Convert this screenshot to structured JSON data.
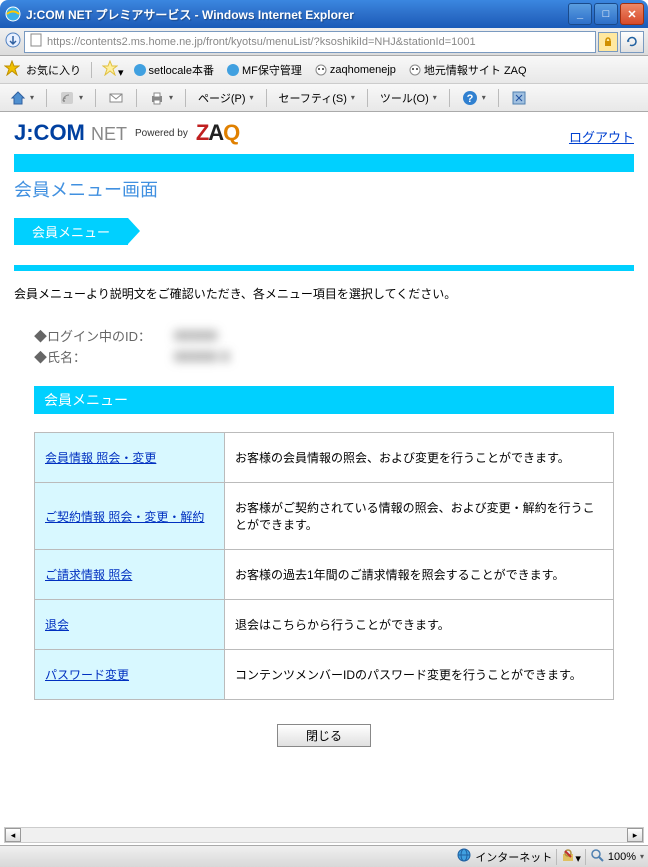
{
  "window": {
    "title": "J:COM NET プレミアサービス - Windows Internet Explorer"
  },
  "address": {
    "url": "https://contents2.ms.home.ne.jp/front/kyotsu/menuList/?ksoshikiId=NHJ&stationId=1001"
  },
  "favbar": {
    "label": "お気に入り",
    "items": [
      "setlocale本番",
      "MF保守管理",
      "zaqhomenejp",
      "地元情報サイト ZAQ"
    ]
  },
  "toolbar": {
    "page": "ページ(P)",
    "safety": "セーフティ(S)",
    "tools": "ツール(O)"
  },
  "brand": {
    "jcom": "J:COM",
    "net": "NET",
    "powered": "Powered by",
    "zaq_z": "Z",
    "zaq_a": "A",
    "zaq_q": "Q"
  },
  "header": {
    "logout": "ログアウト",
    "page_title": "会員メニュー画面",
    "ribbon": "会員メニュー",
    "instruction": "会員メニューより説明文をご確認いただき、各メニュー項目を選択してください。"
  },
  "userinfo": {
    "id_label": "◆ログイン中のID：",
    "name_label": "◆氏名：",
    "id_value": "XXXXX",
    "name_value": "XXXXX X"
  },
  "menu": {
    "heading": "会員メニュー",
    "rows": [
      {
        "link": "会員情報 照会・変更",
        "desc": "お客様の会員情報の照会、および変更を行うことができます。"
      },
      {
        "link": "ご契約情報 照会・変更・解約",
        "desc": "お客様がご契約されている情報の照会、および変更・解約を行うことができます。"
      },
      {
        "link": "ご請求情報 照会",
        "desc": "お客様の過去1年間のご請求情報を照会することができます。"
      },
      {
        "link": "退会",
        "desc": "退会はこちらから行うことができます。"
      },
      {
        "link": "パスワード変更",
        "desc": "コンテンツメンバーIDのパスワード変更を行うことができます。"
      }
    ],
    "close_btn": "閉じる"
  },
  "status": {
    "zone": "インターネット",
    "zoom": "100%"
  }
}
